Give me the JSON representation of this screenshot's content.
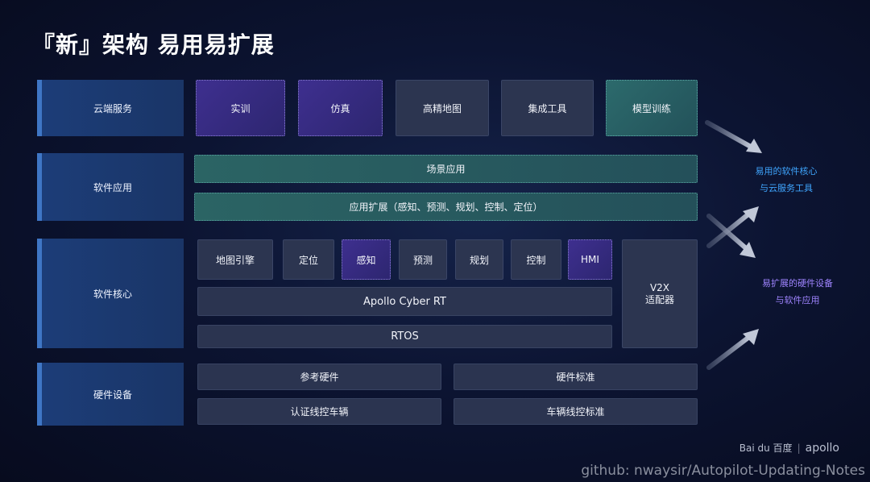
{
  "title": "『新』架构 易用易扩展",
  "categories": {
    "cloud": "云端服务",
    "software_app": "软件应用",
    "software_core": "软件核心",
    "hardware": "硬件设备"
  },
  "cloud_services": [
    "实训",
    "仿真",
    "高精地图",
    "集成工具",
    "模型训练"
  ],
  "software_app": {
    "scene": "场景应用",
    "extension": "应用扩展（感知、预测、规划、控制、定位）"
  },
  "software_core": {
    "modules": [
      "地图引擎",
      "定位",
      "感知",
      "预测",
      "规划",
      "控制",
      "HMI"
    ],
    "cyber_rt": "Apollo Cyber RT",
    "rtos": "RTOS",
    "v2x_line1": "V2X",
    "v2x_line2": "适配器"
  },
  "hardware": {
    "ref_hw": "参考硬件",
    "hw_std": "硬件标准",
    "cert_drive": "认证线控车辆",
    "vehicle_std": "车辆线控标准"
  },
  "notes": {
    "software_line1": "易用的软件核心",
    "software_line2": "与云服务工具",
    "hardware_line1": "易扩展的硬件设备",
    "hardware_line2": "与软件应用"
  },
  "logo": {
    "baidu": "Bai du 百度",
    "apollo": "apollo"
  },
  "watermark": "github: nwaysir/Autopilot-Updating-Notes",
  "colors": {
    "note_blue": "#3fa6ff",
    "note_purple": "#9f84ff",
    "arrow": "#a9b2c6"
  }
}
